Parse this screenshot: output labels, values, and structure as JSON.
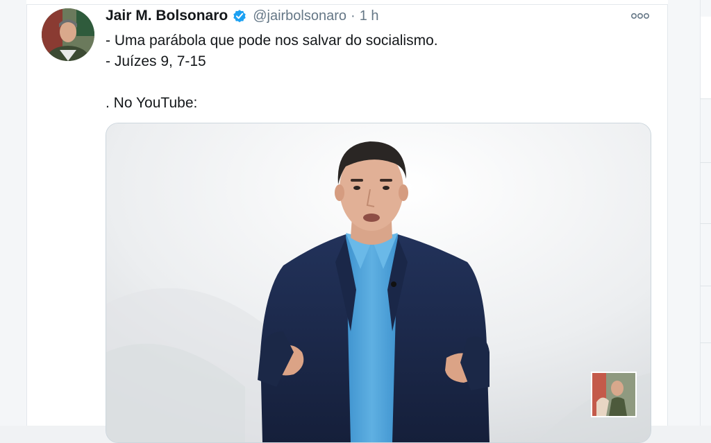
{
  "tweet": {
    "author_name": "Jair M. Bolsonaro",
    "handle": "@jairbolsonaro",
    "separator": "·",
    "time": "1 h",
    "text_lines": [
      "- Uma parábola que pode nos salvar do socialismo.",
      "- Juízes 9, 7-15",
      "",
      ". No YouTube:"
    ]
  },
  "icons": {
    "verified": "verified-badge-icon",
    "more": "more-options-icon"
  },
  "colors": {
    "verified_blue": "#1da1f2",
    "text_primary": "#14171a",
    "text_secondary": "#657786",
    "suit_navy": "#1c2a4a",
    "shirt_blue": "#4fa3d9"
  }
}
